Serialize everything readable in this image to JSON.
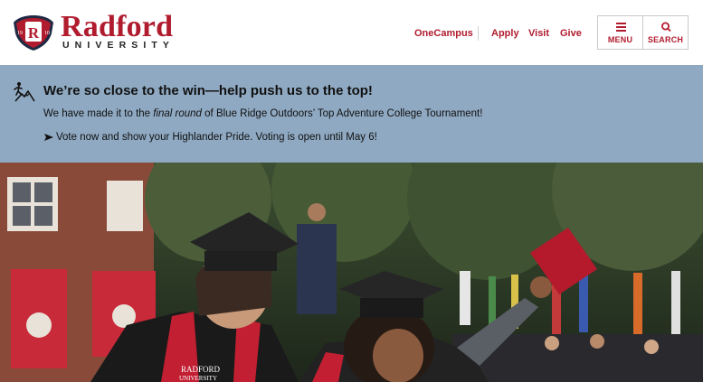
{
  "header": {
    "logo_wordmark": "Radford",
    "logo_subtitle": "UNIVERSITY",
    "seal_letter": "R",
    "seal_left": "19",
    "seal_right": "10",
    "nav": [
      {
        "label": "OneCampus"
      },
      {
        "label": "Apply"
      },
      {
        "label": "Visit"
      },
      {
        "label": "Give"
      }
    ],
    "menu_label": "MENU",
    "search_label": "SEARCH"
  },
  "alert": {
    "title": "We’re so close to the win—help push us to the top!",
    "body_pre": "We have made it to the ",
    "body_em": "final round",
    "body_post": " of Blue Ridge Outdoors’ Top Adventure College Tournament!",
    "link": "Vote now and show your Highlander Pride. Voting is open until May 6!"
  },
  "hero": {
    "sash_text_1": "RADFORD",
    "sash_text_2": "UNIVERSITY"
  },
  "colors": {
    "brand_red": "#b01c2e",
    "alert_bg": "#8fa9c2"
  }
}
